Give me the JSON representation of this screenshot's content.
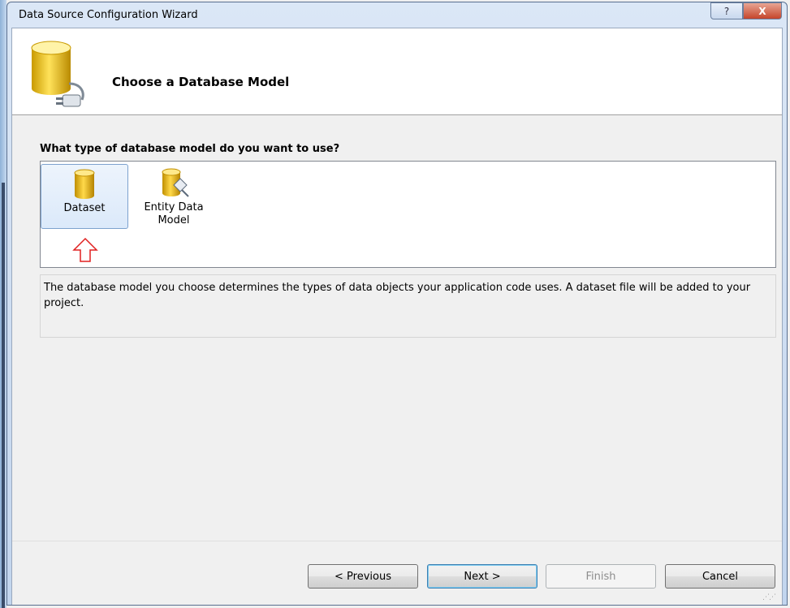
{
  "window": {
    "title": "Data Source Configuration Wizard",
    "help_glyph": "?",
    "close_glyph": "X"
  },
  "header": {
    "title": "Choose a Database Model"
  },
  "question": "What type of database model do you want to use?",
  "models": [
    {
      "label_line1": "Dataset",
      "label_line2": "",
      "selected": true
    },
    {
      "label_line1": "Entity Data",
      "label_line2": "Model",
      "selected": false
    }
  ],
  "description": "The database model you choose determines the types of data objects your application code uses. A dataset file will be added to your project.",
  "buttons": {
    "previous": "< Previous",
    "next": "Next >",
    "finish": "Finish",
    "cancel": "Cancel"
  },
  "colors": {
    "selection_border": "#7da2ce",
    "annotation_arrow": "#e02020",
    "db_gold": "#e8b800"
  }
}
